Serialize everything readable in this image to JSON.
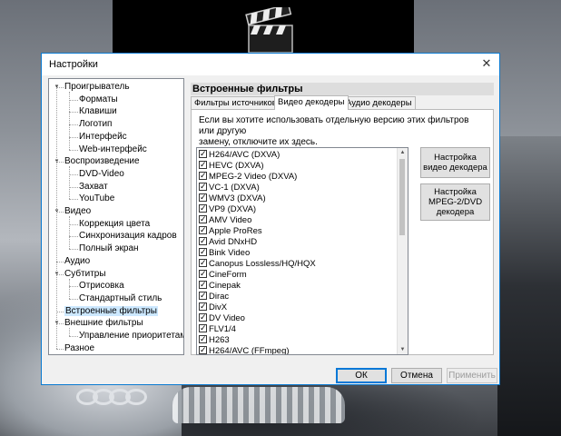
{
  "window": {
    "title": "Настройки",
    "close_glyph": "✕"
  },
  "tree": [
    {
      "label": "Проигрыватель",
      "level": 0,
      "expanded": true
    },
    {
      "label": "Форматы",
      "level": 1
    },
    {
      "label": "Клавиши",
      "level": 1
    },
    {
      "label": "Логотип",
      "level": 1
    },
    {
      "label": "Интерфейс",
      "level": 1
    },
    {
      "label": "Web-интерфейс",
      "level": 1
    },
    {
      "label": "Воспроизведение",
      "level": 0,
      "expanded": true
    },
    {
      "label": "DVD-Video",
      "level": 1
    },
    {
      "label": "Захват",
      "level": 1
    },
    {
      "label": "YouTube",
      "level": 1
    },
    {
      "label": "Видео",
      "level": 0,
      "expanded": true
    },
    {
      "label": "Коррекция цвета",
      "level": 1
    },
    {
      "label": "Синхронизация кадров",
      "level": 1
    },
    {
      "label": "Полный экран",
      "level": 1
    },
    {
      "label": "Аудио",
      "level": 0
    },
    {
      "label": "Субтитры",
      "level": 0,
      "expanded": true
    },
    {
      "label": "Отрисовка",
      "level": 1
    },
    {
      "label": "Стандартный стиль",
      "level": 1
    },
    {
      "label": "Встроенные фильтры",
      "level": 0,
      "selected": true
    },
    {
      "label": "Внешние фильтры",
      "level": 0,
      "expanded": true
    },
    {
      "label": "Управление приоритетами",
      "level": 1
    },
    {
      "label": "Разное",
      "level": 0
    }
  ],
  "panel": {
    "title": "Встроенные фильтры",
    "tabs": [
      {
        "label": "Фильтры источников",
        "active": false
      },
      {
        "label": "Видео декодеры",
        "active": true
      },
      {
        "label": "Аудио декодеры",
        "active": false
      }
    ],
    "description_line1": "Если вы хотите использовать отдельную версию этих фильтров или другую",
    "description_line2": "замену, отключите их здесь.",
    "filters": [
      {
        "label": "H264/AVC (DXVA)",
        "checked": true
      },
      {
        "label": "HEVC (DXVA)",
        "checked": true
      },
      {
        "label": "MPEG-2 Video (DXVA)",
        "checked": true
      },
      {
        "label": "VC-1 (DXVA)",
        "checked": true
      },
      {
        "label": "WMV3 (DXVA)",
        "checked": true
      },
      {
        "label": "VP9 (DXVA)",
        "checked": true
      },
      {
        "label": "AMV Video",
        "checked": true
      },
      {
        "label": "Apple ProRes",
        "checked": true
      },
      {
        "label": "Avid DNxHD",
        "checked": true
      },
      {
        "label": "Bink Video",
        "checked": true
      },
      {
        "label": "Canopus Lossless/HQ/HQX",
        "checked": true
      },
      {
        "label": "CineForm",
        "checked": true
      },
      {
        "label": "Cinepak",
        "checked": true
      },
      {
        "label": "Dirac",
        "checked": true
      },
      {
        "label": "DivX",
        "checked": true
      },
      {
        "label": "DV Video",
        "checked": true
      },
      {
        "label": "FLV1/4",
        "checked": true
      },
      {
        "label": "H263",
        "checked": true
      },
      {
        "label": "H264/AVC (FFmpeg)",
        "checked": true
      }
    ],
    "btn_video_decoder_l1": "Настройка",
    "btn_video_decoder_l2": "видео декодера",
    "btn_mpeg2_l1": "Настройка",
    "btn_mpeg2_l2": "MPEG-2/DVD",
    "btn_mpeg2_l3": "декодера"
  },
  "buttons": {
    "ok": "ОК",
    "cancel": "Отмена",
    "apply": "Применить"
  },
  "wallpaper": {
    "brand": "audi-rings"
  }
}
